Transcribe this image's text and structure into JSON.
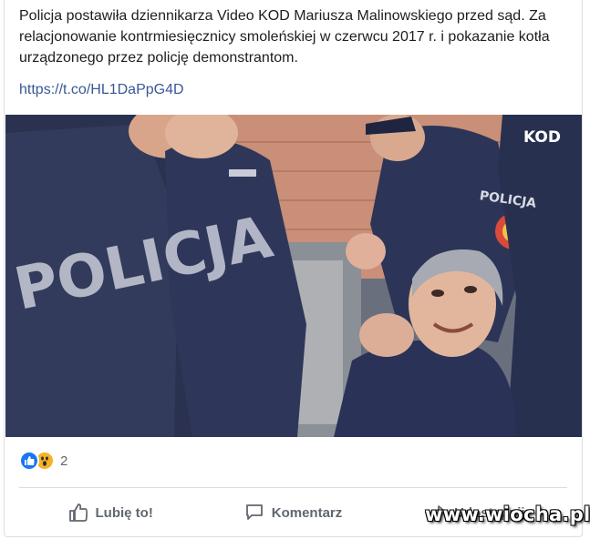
{
  "post": {
    "text": "Policja postawiła dziennikarza Video KOD Mariusza Malinowskiego przed sąd. Za relacjonowanie kontrmiesięcznicy smoleńskiej w czerwcu 2017 r. i pokazanie kotła urządzonego przez policję demonstrantom.",
    "link": "https://t.co/HL1DaPpG4D"
  },
  "image_text": {
    "vest_left": "POLICJA",
    "vest_right": "POLICJA",
    "kod": "KOD"
  },
  "reactions": {
    "icons": [
      "like-icon",
      "wow-icon"
    ],
    "count": "2",
    "like_color": "#1877f2",
    "wow_color": "#f7b125"
  },
  "actions": {
    "like": "Lubię to!",
    "comment": "Komentarz",
    "share": "Udostępnij"
  },
  "watermark": "www.wiocha.pl"
}
